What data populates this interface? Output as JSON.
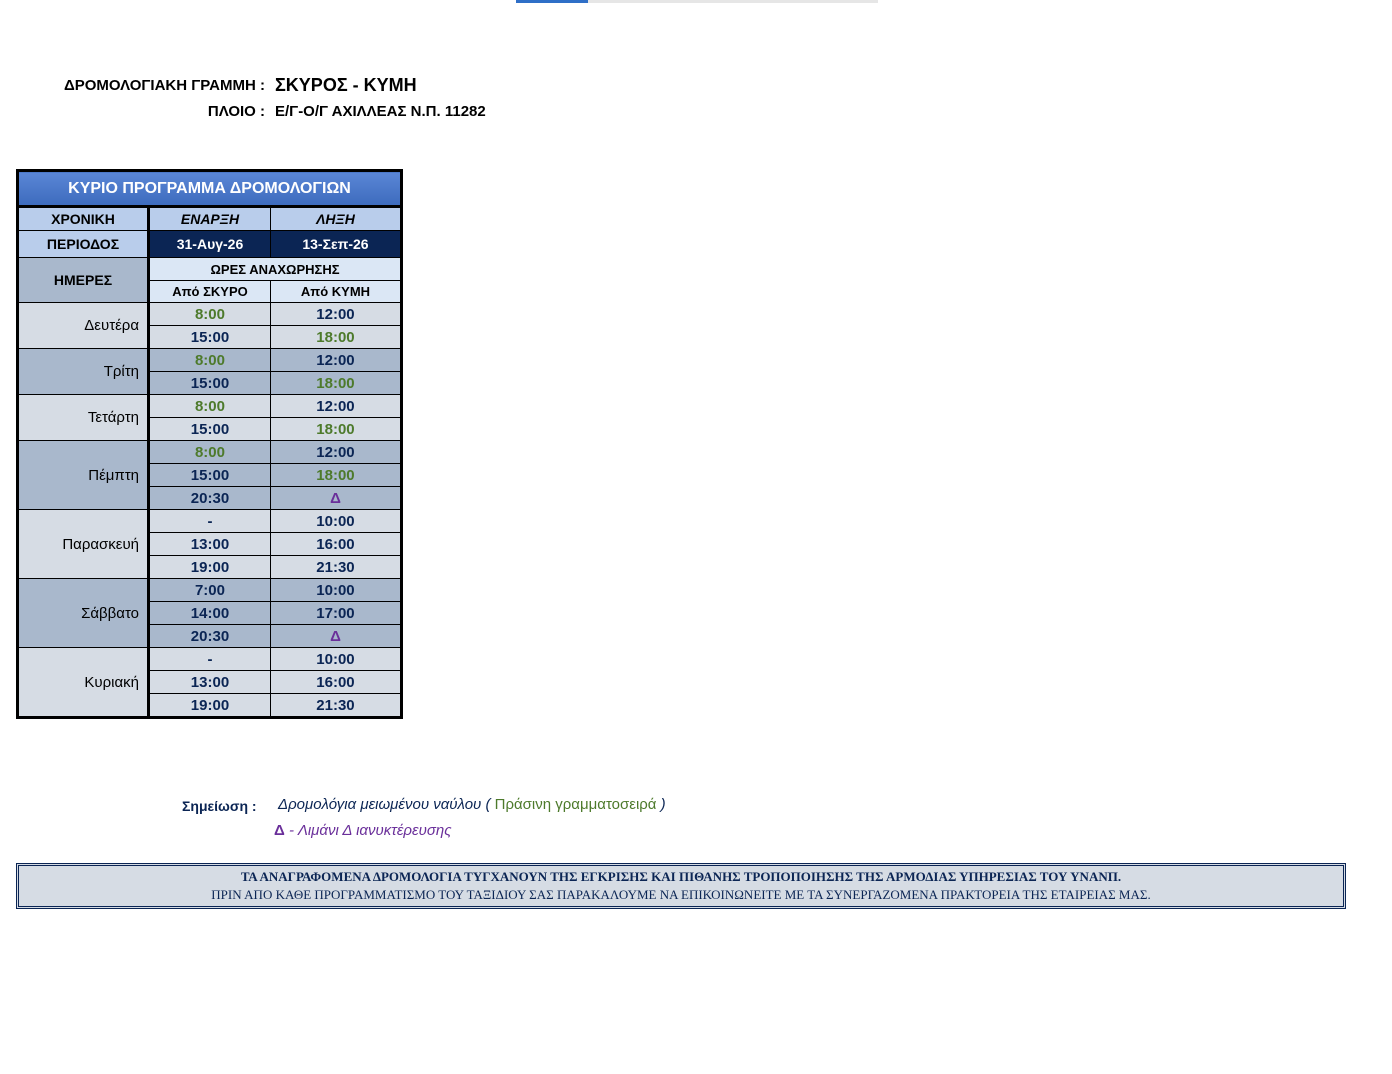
{
  "header": {
    "route_label": "ΔΡΟΜΟΛΟΓΙΑΚΗ ΓΡΑΜΜΗ :",
    "route_value": "ΣΚΥΡΟΣ - ΚΥΜΗ",
    "ship_label": "ΠΛΟΙΟ :",
    "ship_value": "Ε/Γ-Ο/Γ ΑΧΙΛΛΕΑΣ Ν.Π. 11282"
  },
  "table": {
    "title": "ΚΥΡΙΟ ΠΡΟΓΡΑΜΜΑ ΔΡΟΜΟΛΟΓΙΩΝ",
    "period_label_1": "ΧΡΟΝΙΚΗ",
    "period_label_2": "ΠΕΡΙΟΔΟΣ",
    "start_label": "ΕΝΑΡΞΗ",
    "end_label": "ΛΗΞΗ",
    "start_date": "31-Αυγ-26",
    "end_date": "13-Σεπ-26",
    "days_label": "ΗΜΕΡΕΣ",
    "departures_label": "ΩΡΕΣ ΑΝΑΧΩΡΗΣΗΣ",
    "from_a": "Από ΣΚΥΡΟ",
    "from_b": "Από ΚΥΜΗ",
    "days": [
      {
        "name": "Δευτέρα",
        "rows": [
          [
            "8:00",
            "12:00"
          ],
          [
            "15:00",
            "18:00"
          ]
        ]
      },
      {
        "name": "Τρίτη",
        "rows": [
          [
            "8:00",
            "12:00"
          ],
          [
            "15:00",
            "18:00"
          ]
        ]
      },
      {
        "name": "Τετάρτη",
        "rows": [
          [
            "8:00",
            "12:00"
          ],
          [
            "15:00",
            "18:00"
          ]
        ]
      },
      {
        "name": "Πέμπτη",
        "rows": [
          [
            "8:00",
            "12:00"
          ],
          [
            "15:00",
            "18:00"
          ],
          [
            "20:30",
            "Δ"
          ]
        ]
      },
      {
        "name": "Παρασκευή",
        "rows": [
          [
            "-",
            "10:00"
          ],
          [
            "13:00",
            "16:00"
          ],
          [
            "19:00",
            "21:30"
          ]
        ]
      },
      {
        "name": "Σάββατο",
        "rows": [
          [
            "7:00",
            "10:00"
          ],
          [
            "14:00",
            "17:00"
          ],
          [
            "20:30",
            "Δ"
          ]
        ]
      },
      {
        "name": "Κυριακή",
        "rows": [
          [
            "-",
            "10:00"
          ],
          [
            "13:00",
            "16:00"
          ],
          [
            "19:00",
            "21:30"
          ]
        ]
      }
    ]
  },
  "notes": {
    "label": "Σημείωση :",
    "text_prefix": "Δρομολόγια μειωμένου ναύλου (",
    "text_green": "Πράσινη γραμματοσειρά",
    "text_suffix": ")",
    "delta_symbol": "Δ",
    "delta_text": "- Λιμάνι  Δ ιανυκτέρευσης"
  },
  "disclaimer": {
    "line1": "ΤΑ ΑΝΑΓΡΑΦΟΜΕΝΑ ΔΡΟΜΟΛΟΓΙΑ ΤΥΓΧΑΝΟΥΝ ΤΗΣ ΕΓΚΡΙΣΗΣ ΚΑΙ ΠΙΘΑΝΗΣ ΤΡΟΠΟΠΟΙΗΣΗΣ ΤΗΣ ΑΡΜΟΔΙΑΣ ΥΠΗΡΕΣΙΑΣ ΤΟΥ ΥΝΑΝΠ.",
    "line2": "ΠΡΙΝ ΑΠΟ ΚΑΘΕ ΠΡΟΓΡΑΜΜΑΤΙΣΜΟ ΤΟΥ ΤΑΞΙΔΙΟΥ ΣΑΣ ΠΑΡΑΚΑΛΟΥΜΕ ΝΑ ΕΠΙΚΟΙΝΩΝΕΙΤΕ ΜΕ ΤΑ ΣΥΝΕΡΓΑΖΟΜΕΝΑ ΠΡΑΚΤΟΡΕΙΑ ΤΗΣ ΕΤΑΙΡΕΙΑΣ ΜΑΣ."
  },
  "colors": {
    "navy": "#0b2554",
    "green": "#4d7a2b",
    "purple": "#6a2f9a",
    "header_blue": "#3d6bbd"
  }
}
